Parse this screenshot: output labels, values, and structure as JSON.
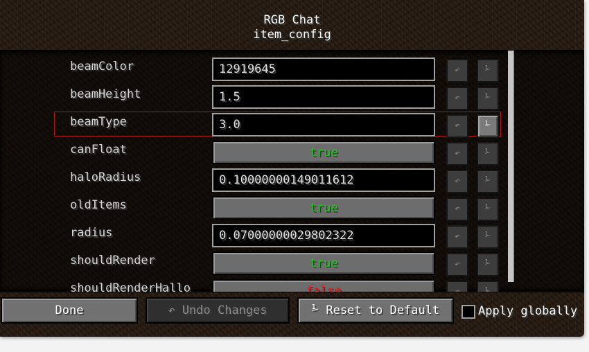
{
  "title": {
    "line1": "RGB Chat",
    "line2": "item_config"
  },
  "icons": {
    "undo": "↶",
    "reset": "⅟"
  },
  "entries": [
    {
      "name": "beamColor",
      "type": "text",
      "value": "12919645"
    },
    {
      "name": "beamHeight",
      "type": "text",
      "value": "1.5"
    },
    {
      "name": "beamType",
      "type": "text",
      "value": "3.0",
      "selected": true
    },
    {
      "name": "canFloat",
      "type": "toggle",
      "value": "true"
    },
    {
      "name": "haloRadius",
      "type": "text",
      "value": "0.10000000149011612"
    },
    {
      "name": "oldItems",
      "type": "toggle",
      "value": "true"
    },
    {
      "name": "radius",
      "type": "text",
      "value": "0.07000000029802322"
    },
    {
      "name": "shouldRender",
      "type": "toggle",
      "value": "true"
    },
    {
      "name": "shouldRenderHallo",
      "type": "toggle",
      "value": "false"
    }
  ],
  "buttons": {
    "done": "Done",
    "undo_changes": "↶ Undo Changes",
    "reset_default": "⅟ Reset to Default",
    "apply_globally": "Apply globally"
  },
  "colors": {
    "true_text": "#19c619",
    "false_text": "#e01c1c",
    "selection_border": "#b51818"
  }
}
